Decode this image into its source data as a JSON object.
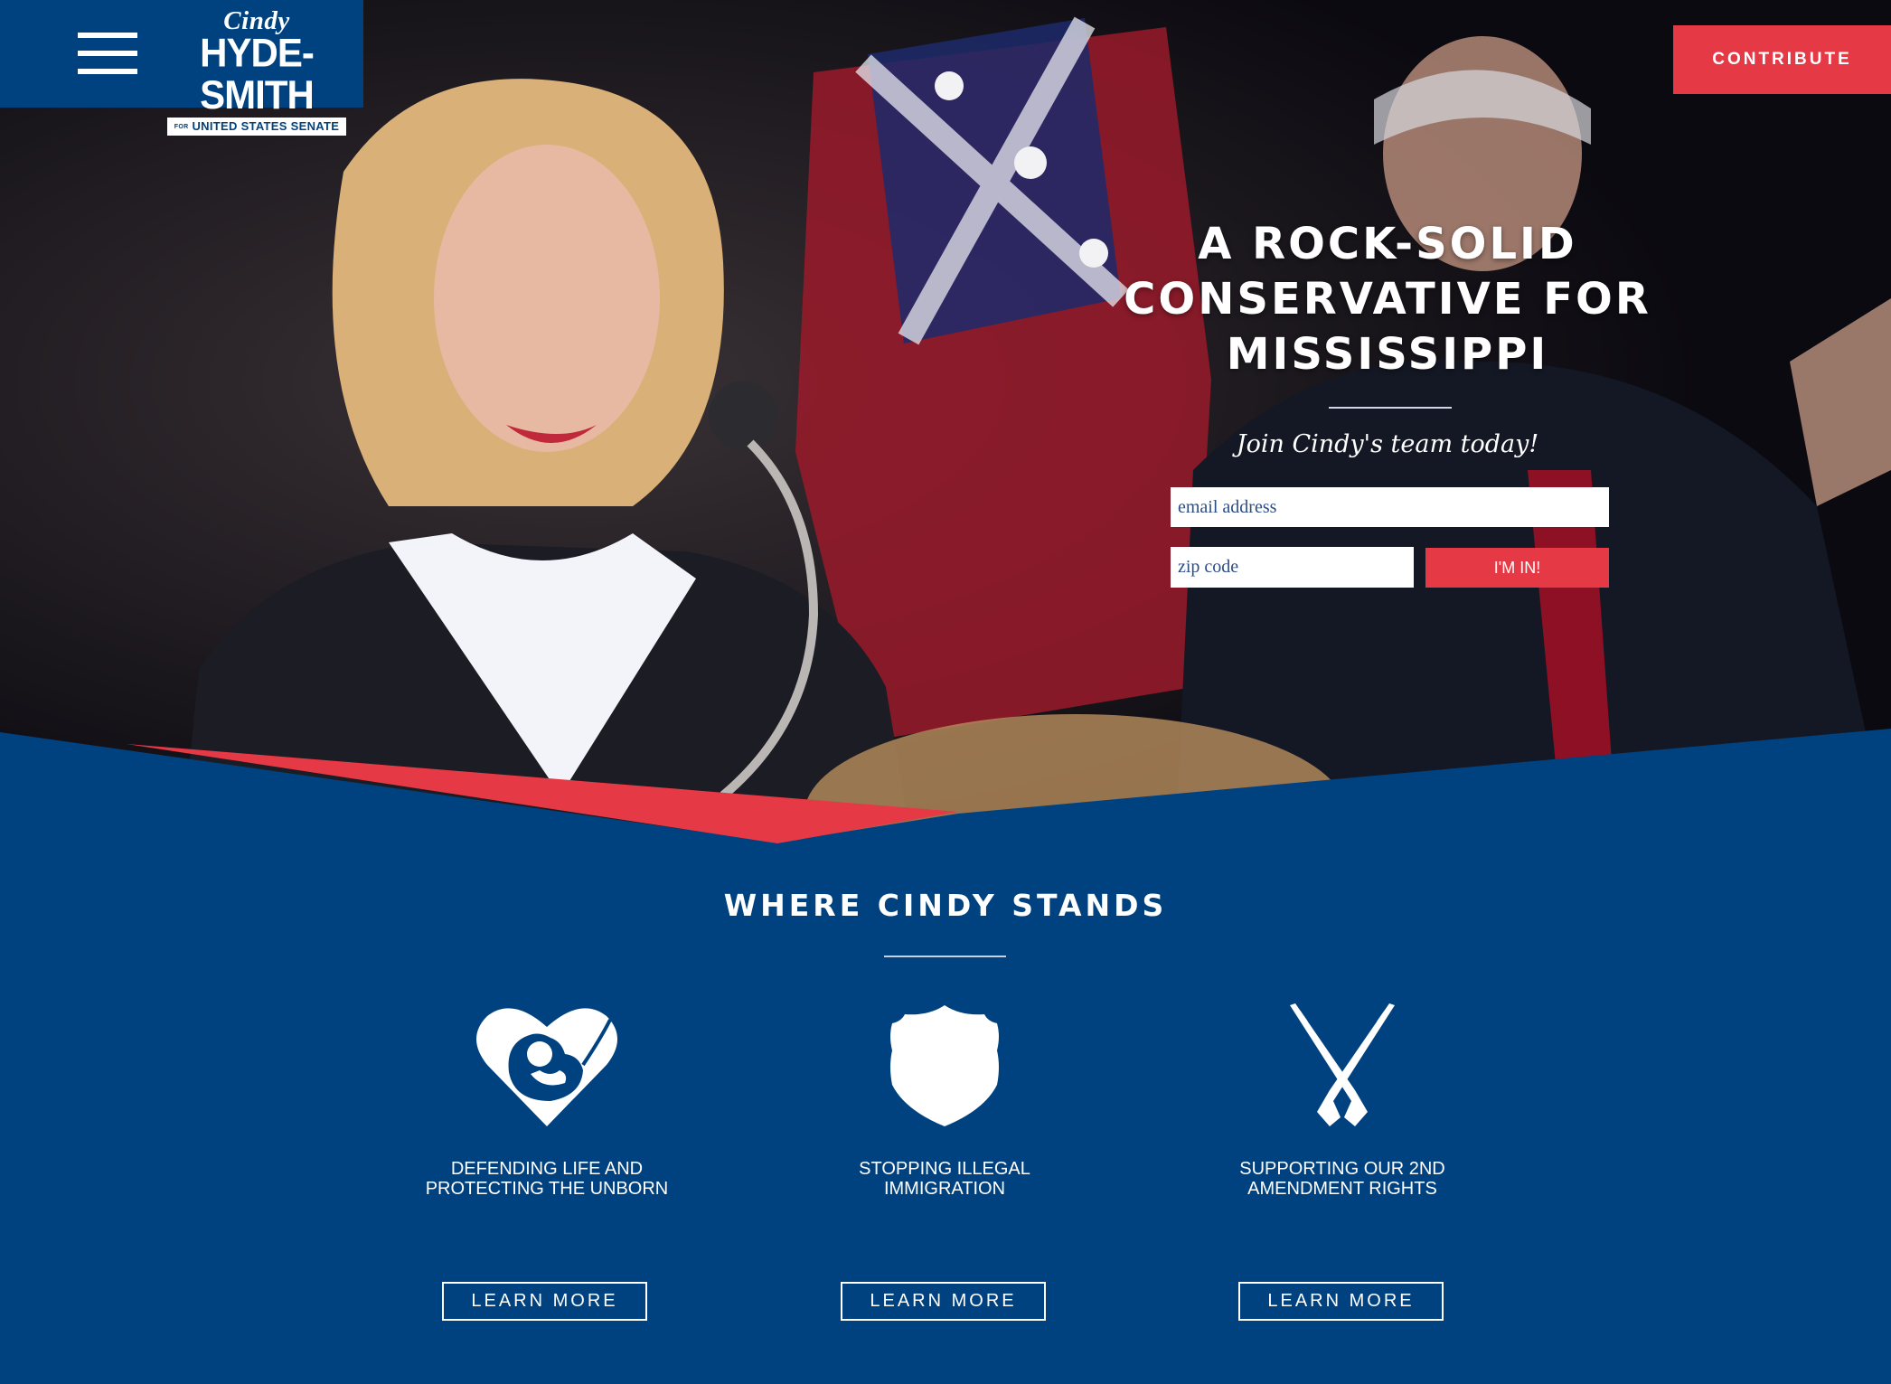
{
  "header": {
    "logo": {
      "first_name": "Cindy",
      "last_name": "HYDE-SMITH",
      "for_label": "FOR",
      "tagline": "UNITED STATES SENATE"
    },
    "menu_icon": "hamburger-menu-icon",
    "contribute_label": "CONTRIBUTE"
  },
  "hero": {
    "headline": "A ROCK-SOLID CONSERVATIVE FOR MISSISSIPPI",
    "subheading": "Join Cindy's team today!",
    "email_placeholder": "email address",
    "zip_placeholder": "zip code",
    "submit_label": "I'M IN!"
  },
  "issues": {
    "title": "WHERE CINDY STANDS",
    "items": [
      {
        "icon": "heart-unborn-icon",
        "label": "DEFENDING LIFE AND\nPROTECTING THE UNBORN",
        "button": "LEARN MORE"
      },
      {
        "icon": "shield-icon",
        "label": "STOPPING ILLEGAL\nIMMIGRATION",
        "button": "LEARN MORE"
      },
      {
        "icon": "crossed-rifles-icon",
        "label": "SUPPORTING OUR 2ND\nAMENDMENT RIGHTS",
        "button": "LEARN MORE"
      }
    ]
  },
  "colors": {
    "navy": "#004280",
    "red": "#e63946",
    "white": "#ffffff"
  }
}
